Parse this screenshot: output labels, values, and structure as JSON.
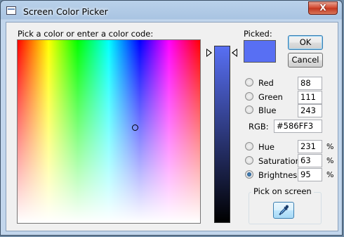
{
  "window": {
    "title": "Screen Color Picker",
    "close_glyph": "X"
  },
  "picker": {
    "prompt": "Pick a color or enter a color code:",
    "picked_label": "Picked:",
    "picked_color": "#586FF3"
  },
  "buttons": {
    "ok": "OK",
    "cancel": "Cancel"
  },
  "rgb_fields": [
    {
      "label": "Red",
      "value": "88"
    },
    {
      "label": "Green",
      "value": "111"
    },
    {
      "label": "Blue",
      "value": "243"
    }
  ],
  "hex": {
    "label": "RGB:",
    "value": "#586FF3"
  },
  "hsb_fields": [
    {
      "label": "Hue",
      "value": "231",
      "unit": "%"
    },
    {
      "label": "Saturation",
      "value": "63",
      "unit": "%"
    },
    {
      "label": "Brightness",
      "value": "95",
      "unit": "%",
      "selected": true
    }
  ],
  "pick_on_screen": {
    "label": "Pick on screen",
    "icon": "eyedropper-icon"
  }
}
